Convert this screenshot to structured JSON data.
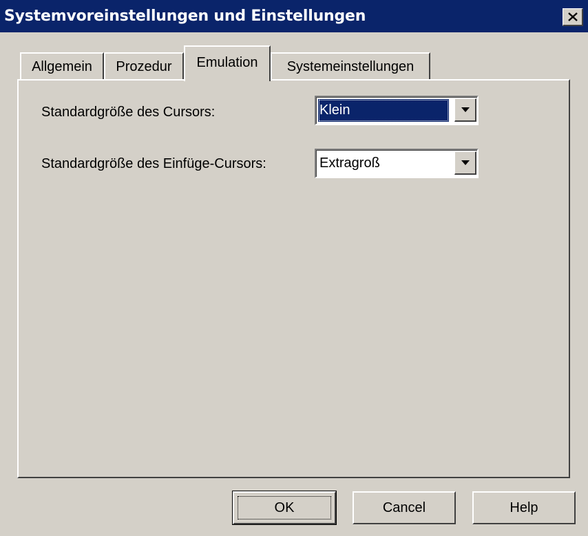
{
  "window": {
    "title": "Systemvoreinstellungen und Einstellungen",
    "close_icon": "close-icon"
  },
  "tabs": [
    {
      "label": "Allgemein",
      "active": false
    },
    {
      "label": "Prozedur",
      "active": false
    },
    {
      "label": "Emulation",
      "active": true
    },
    {
      "label": "Systemeinstellungen",
      "active": false
    }
  ],
  "emulation": {
    "cursor_size": {
      "label": "Standardgröße des Cursors:",
      "value": "Klein",
      "focused": true
    },
    "insert_cursor_size": {
      "label": "Standardgröße des Einfüge-Cursors:",
      "value": "Extragroß",
      "focused": false
    }
  },
  "buttons": {
    "ok": "OK",
    "cancel": "Cancel",
    "help": "Help"
  },
  "colors": {
    "titlebar": "#0a246a",
    "face": "#d4d0c8",
    "selection": "#0a246a"
  }
}
